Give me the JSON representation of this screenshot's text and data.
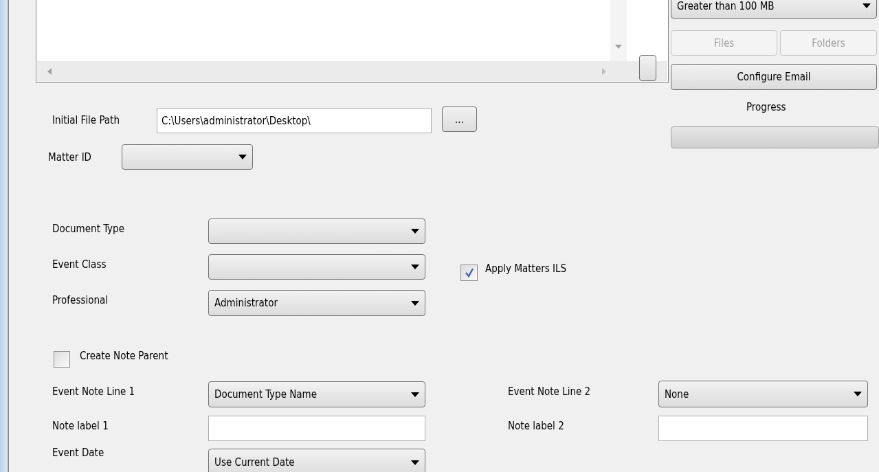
{
  "size_filter": {
    "value": "Greater than 100 MB"
  },
  "scope_buttons": [
    {
      "label": "Files",
      "disabled": true
    },
    {
      "label": "Folders",
      "disabled": true
    }
  ],
  "configure_button": {
    "label": "Configure Email"
  },
  "progress": {
    "label": "Progress",
    "level": 0
  },
  "form": [
    {
      "kind": "text",
      "label": "Initial File Path",
      "value": "C:\\Users\\administrator\\Desktop\\"
    },
    {
      "kind": "browse",
      "label": "..."
    },
    {
      "kind": "dropdown",
      "label": "Matter ID"
    },
    {
      "kind": "dropdown",
      "label": "Document Type"
    },
    {
      "kind": "dropdown",
      "label": "Event Class"
    },
    {
      "kind": "checkbox",
      "label": "Apply Matters ILS",
      "checked": true
    },
    {
      "kind": "dropdown",
      "label": "Professional",
      "value": "Administrator"
    },
    {
      "kind": "checkbox",
      "label": "Create Note Parent",
      "checked": false
    },
    {
      "kind": "dropdown",
      "label": "Event Note Line 1",
      "value": "Document Type Name"
    },
    {
      "kind": "dropdown",
      "label": "Event Note Line 2",
      "value": "None"
    },
    {
      "kind": "text",
      "label": "Note label 1"
    },
    {
      "kind": "text",
      "label": "Note label 2"
    },
    {
      "kind": "dropdown",
      "label": "Event Date",
      "value": "Use Current Date"
    }
  ]
}
